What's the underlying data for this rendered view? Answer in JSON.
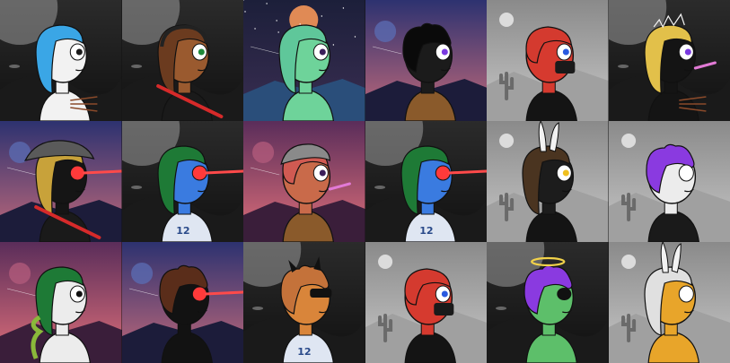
{
  "gallery": {
    "columns": 6,
    "rows": 3,
    "tiles": [
      {
        "background": "night",
        "skin": "#f2f2f2",
        "hair": "#3aa6e6",
        "hair_style": "long",
        "clothing": "none",
        "eye": "normal",
        "accessories": [
          "arrows"
        ]
      },
      {
        "background": "night",
        "skin": "#9a5a2f",
        "hair": "#6b3b1f",
        "hair_style": "long",
        "clothing": "black-shirt",
        "eye": "green",
        "accessories": [
          "headphones",
          "crowbar"
        ]
      },
      {
        "background": "starry-desert",
        "skin": "#6ed39a",
        "hair": "#5fc79a",
        "hair_style": "long",
        "clothing": "none",
        "eye": "bruised",
        "accessories": []
      },
      {
        "background": "purple-dusk",
        "skin": "#1b1b1b",
        "hair": "#0a0a0a",
        "hair_style": "curly",
        "clothing": "brown-hoodie",
        "eye": "purple",
        "accessories": []
      },
      {
        "background": "grey-desert",
        "skin": "#d63a2f",
        "hair": "#d43a2f",
        "hair_style": "short",
        "clothing": "black-hoodie",
        "eye": "blue",
        "accessories": [
          "mask"
        ]
      },
      {
        "background": "night",
        "skin": "#141414",
        "hair": "#e2c04a",
        "hair_style": "long",
        "clothing": "none",
        "eye": "purple",
        "accessories": [
          "lightning",
          "party-horn",
          "arrows"
        ]
      },
      {
        "background": "purple-dusk",
        "skin": "#151515",
        "hair": "#c8a23a",
        "hair_style": "long",
        "clothing": "black-shirt",
        "eye": "laser",
        "accessories": [
          "bucket-hat",
          "crowbar"
        ]
      },
      {
        "background": "night",
        "skin": "#3a7be0",
        "hair": "#1e7a36",
        "hair_style": "long",
        "clothing": "jersey",
        "eye": "laser",
        "accessories": []
      },
      {
        "background": "pink-sunset",
        "skin": "#c96a4a",
        "hair": "#d05a52",
        "hair_style": "short",
        "clothing": "brown-hoodie",
        "eye": "bruised",
        "accessories": [
          "cap",
          "party-horn"
        ]
      },
      {
        "background": "night",
        "skin": "#3a7be0",
        "hair": "#1e7a36",
        "hair_style": "long",
        "clothing": "jersey",
        "eye": "laser",
        "accessories": []
      },
      {
        "background": "grey-desert",
        "skin": "#1c1c1c",
        "hair": "#4a3420",
        "hair_style": "long",
        "clothing": "black-hoodie",
        "eye": "cyclops",
        "accessories": [
          "bunny-ears"
        ]
      },
      {
        "background": "grey-desert",
        "skin": "#ececec",
        "hair": "#8a3ae0",
        "hair_style": "curly",
        "clothing": "black-shirt",
        "eye": "white",
        "accessories": []
      },
      {
        "background": "pink-sunset",
        "skin": "#ececec",
        "hair": "#1e7a36",
        "hair_style": "long",
        "clothing": "none",
        "eye": "skull",
        "accessories": [
          "snake"
        ]
      },
      {
        "background": "purple-dusk",
        "skin": "#121212",
        "hair": "#5a2d1a",
        "hair_style": "curly",
        "clothing": "none",
        "eye": "laser",
        "accessories": []
      },
      {
        "background": "night",
        "skin": "#d9853a",
        "hair": "#c4723a",
        "hair_style": "curly",
        "clothing": "jersey",
        "eye": "shades",
        "accessories": [
          "horns"
        ]
      },
      {
        "background": "grey-desert",
        "skin": "#d63a2f",
        "hair": "#d43a2f",
        "hair_style": "short",
        "clothing": "black-hoodie",
        "eye": "blue",
        "accessories": [
          "mask"
        ]
      },
      {
        "background": "night",
        "skin": "#5dbf6a",
        "hair": "#8a3ae0",
        "hair_style": "curly",
        "clothing": "none",
        "eye": "eyepatch",
        "accessories": [
          "halo"
        ]
      },
      {
        "background": "grey-desert",
        "skin": "#e8a52a",
        "hair": "#e0e0e0",
        "hair_style": "long",
        "clothing": "none",
        "eye": "white",
        "accessories": [
          "bunny-ears"
        ]
      }
    ]
  },
  "labels": {
    "jersey_number": "12"
  }
}
